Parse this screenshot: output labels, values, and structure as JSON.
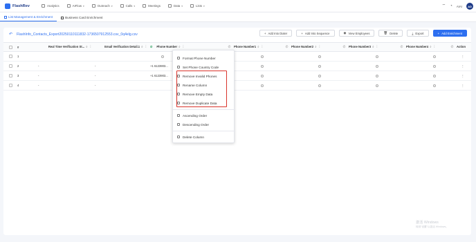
{
  "app": {
    "logo_text": "FlashRev"
  },
  "nav": [
    {
      "label": "Analytics",
      "icon": "chart-icon",
      "caret": false
    },
    {
      "label": "AIFlow",
      "icon": "flow-icon",
      "caret": true
    },
    {
      "label": "Outreach",
      "icon": "outreach-icon",
      "caret": true
    },
    {
      "label": "Calls",
      "icon": "phone-icon",
      "caret": true
    },
    {
      "label": "Meetings",
      "icon": "calendar-icon",
      "caret": false
    },
    {
      "label": "Data",
      "icon": "database-icon",
      "caret": true
    },
    {
      "label": "Lists",
      "icon": "list-icon",
      "caret": true
    }
  ],
  "user": {
    "name": "AIAI",
    "initials": "AD"
  },
  "tabs": [
    {
      "label": "List Management & Enrichment",
      "active": true
    },
    {
      "label": "Business Card Enrichment",
      "active": false
    }
  ],
  "file": {
    "name": "FlashInfo_Contacts_Export20250110111832-1736507912553.csv_0q4elg.csv"
  },
  "actions": [
    {
      "label": "Add Into Dialer",
      "icon": "+"
    },
    {
      "label": "Add Into Sequence",
      "icon": "+"
    },
    {
      "label": "View Employees",
      "icon": "◉"
    },
    {
      "label": "Delete",
      "icon": "🗑"
    },
    {
      "label": "Export",
      "icon": "⤓"
    },
    {
      "label": "Add Enrichment",
      "icon": "+",
      "primary": true
    }
  ],
  "table": {
    "columns": [
      "#",
      "Real Time Verification St...",
      "Email Verification Detail.1",
      "Phone Number",
      "Phone Number1",
      "Phone Number2",
      "Phone Number3",
      "Phone Number4",
      "Action"
    ],
    "rows": [
      {
        "num": "1",
        "rtv": "",
        "email": "",
        "phone": "",
        "action": "⋮"
      },
      {
        "num": "2",
        "rtv": "-",
        "email": "-",
        "phone": "+1 6123903...",
        "action": "⋮"
      },
      {
        "num": "3",
        "rtv": "-",
        "email": "-",
        "phone": "+1 6123903...",
        "action": "⋮"
      },
      {
        "num": "4",
        "rtv": "-",
        "email": "-",
        "phone": "",
        "action": "⋮"
      }
    ]
  },
  "context_menu": {
    "items": [
      "Format Phone Number",
      "Set Phone Country Code",
      "Remove Invalid Phones",
      "Rename Column",
      "Remove Empty Data",
      "Remove Duplicate Data",
      "Ascending Order",
      "Descending Order",
      "Delete Column"
    ]
  },
  "watermark": {
    "line1": "激活 Windows",
    "line2": "转到\"设置\"以激活 Windows。"
  },
  "colors": {
    "accent": "#2d6ff0",
    "highlight": "#d9332b",
    "success": "#2a9d5c"
  }
}
